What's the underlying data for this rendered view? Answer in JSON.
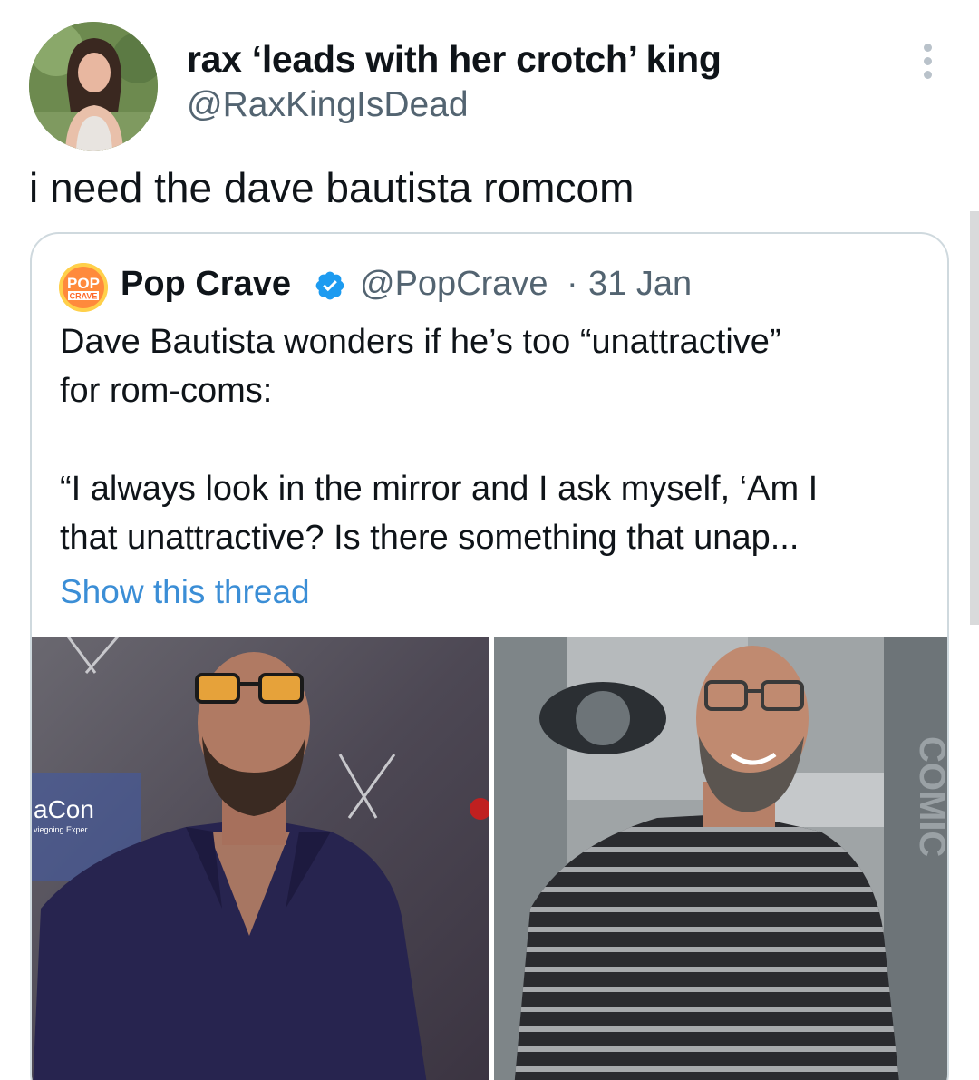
{
  "tweet": {
    "display_name": "rax ‘leads with her crotch’ king",
    "handle": "@RaxKingIsDead",
    "text": "i need the dave bautista romcom"
  },
  "quoted": {
    "name": "Pop Crave",
    "handle": "@PopCrave",
    "separator": "·",
    "date": "31 Jan",
    "avatar_lines": [
      "POP",
      "CRAVE"
    ],
    "lines": [
      "Dave Bautista wonders if he’s too “unattractive”",
      "for rom-coms:",
      "“I always look in the mirror and I ask myself, ‘Am I",
      "that unattractive? Is there something that unap..."
    ],
    "show_thread": "Show this thread",
    "photo_left_backdrop": [
      "aCon",
      "viegoing Exper"
    ],
    "photo_right_backdrop": [
      "COMIC"
    ]
  },
  "colors": {
    "text": "#0f1419",
    "secondary": "#536471",
    "link": "#3b8ed6",
    "verified": "#1d9bf0",
    "border": "#cfd9de"
  },
  "icons": [
    "more-dots-icon",
    "verified-badge-icon"
  ]
}
